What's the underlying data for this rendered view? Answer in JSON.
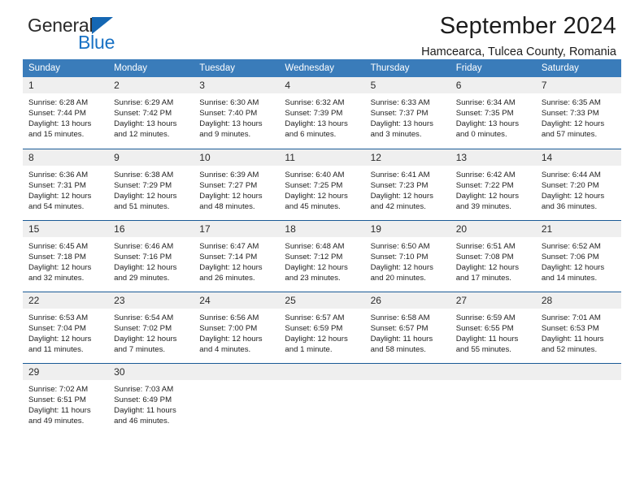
{
  "brand": {
    "name_top": "General",
    "name_bottom": "Blue",
    "triangle_color": "#1567b3",
    "blue_color": "#1871c4"
  },
  "header": {
    "title": "September 2024",
    "subtitle": "Hamcearca, Tulcea County, Romania"
  },
  "theme": {
    "header_bg": "#3a7cba",
    "header_text": "#ffffff",
    "row_divider": "#1a5a96",
    "daynum_bg": "#efefef"
  },
  "weekday_headers": [
    "Sunday",
    "Monday",
    "Tuesday",
    "Wednesday",
    "Thursday",
    "Friday",
    "Saturday"
  ],
  "weeks": [
    [
      {
        "day": "1",
        "sunrise": "Sunrise: 6:28 AM",
        "sunset": "Sunset: 7:44 PM",
        "daylight1": "Daylight: 13 hours",
        "daylight2": "and 15 minutes."
      },
      {
        "day": "2",
        "sunrise": "Sunrise: 6:29 AM",
        "sunset": "Sunset: 7:42 PM",
        "daylight1": "Daylight: 13 hours",
        "daylight2": "and 12 minutes."
      },
      {
        "day": "3",
        "sunrise": "Sunrise: 6:30 AM",
        "sunset": "Sunset: 7:40 PM",
        "daylight1": "Daylight: 13 hours",
        "daylight2": "and 9 minutes."
      },
      {
        "day": "4",
        "sunrise": "Sunrise: 6:32 AM",
        "sunset": "Sunset: 7:39 PM",
        "daylight1": "Daylight: 13 hours",
        "daylight2": "and 6 minutes."
      },
      {
        "day": "5",
        "sunrise": "Sunrise: 6:33 AM",
        "sunset": "Sunset: 7:37 PM",
        "daylight1": "Daylight: 13 hours",
        "daylight2": "and 3 minutes."
      },
      {
        "day": "6",
        "sunrise": "Sunrise: 6:34 AM",
        "sunset": "Sunset: 7:35 PM",
        "daylight1": "Daylight: 13 hours",
        "daylight2": "and 0 minutes."
      },
      {
        "day": "7",
        "sunrise": "Sunrise: 6:35 AM",
        "sunset": "Sunset: 7:33 PM",
        "daylight1": "Daylight: 12 hours",
        "daylight2": "and 57 minutes."
      }
    ],
    [
      {
        "day": "8",
        "sunrise": "Sunrise: 6:36 AM",
        "sunset": "Sunset: 7:31 PM",
        "daylight1": "Daylight: 12 hours",
        "daylight2": "and 54 minutes."
      },
      {
        "day": "9",
        "sunrise": "Sunrise: 6:38 AM",
        "sunset": "Sunset: 7:29 PM",
        "daylight1": "Daylight: 12 hours",
        "daylight2": "and 51 minutes."
      },
      {
        "day": "10",
        "sunrise": "Sunrise: 6:39 AM",
        "sunset": "Sunset: 7:27 PM",
        "daylight1": "Daylight: 12 hours",
        "daylight2": "and 48 minutes."
      },
      {
        "day": "11",
        "sunrise": "Sunrise: 6:40 AM",
        "sunset": "Sunset: 7:25 PM",
        "daylight1": "Daylight: 12 hours",
        "daylight2": "and 45 minutes."
      },
      {
        "day": "12",
        "sunrise": "Sunrise: 6:41 AM",
        "sunset": "Sunset: 7:23 PM",
        "daylight1": "Daylight: 12 hours",
        "daylight2": "and 42 minutes."
      },
      {
        "day": "13",
        "sunrise": "Sunrise: 6:42 AM",
        "sunset": "Sunset: 7:22 PM",
        "daylight1": "Daylight: 12 hours",
        "daylight2": "and 39 minutes."
      },
      {
        "day": "14",
        "sunrise": "Sunrise: 6:44 AM",
        "sunset": "Sunset: 7:20 PM",
        "daylight1": "Daylight: 12 hours",
        "daylight2": "and 36 minutes."
      }
    ],
    [
      {
        "day": "15",
        "sunrise": "Sunrise: 6:45 AM",
        "sunset": "Sunset: 7:18 PM",
        "daylight1": "Daylight: 12 hours",
        "daylight2": "and 32 minutes."
      },
      {
        "day": "16",
        "sunrise": "Sunrise: 6:46 AM",
        "sunset": "Sunset: 7:16 PM",
        "daylight1": "Daylight: 12 hours",
        "daylight2": "and 29 minutes."
      },
      {
        "day": "17",
        "sunrise": "Sunrise: 6:47 AM",
        "sunset": "Sunset: 7:14 PM",
        "daylight1": "Daylight: 12 hours",
        "daylight2": "and 26 minutes."
      },
      {
        "day": "18",
        "sunrise": "Sunrise: 6:48 AM",
        "sunset": "Sunset: 7:12 PM",
        "daylight1": "Daylight: 12 hours",
        "daylight2": "and 23 minutes."
      },
      {
        "day": "19",
        "sunrise": "Sunrise: 6:50 AM",
        "sunset": "Sunset: 7:10 PM",
        "daylight1": "Daylight: 12 hours",
        "daylight2": "and 20 minutes."
      },
      {
        "day": "20",
        "sunrise": "Sunrise: 6:51 AM",
        "sunset": "Sunset: 7:08 PM",
        "daylight1": "Daylight: 12 hours",
        "daylight2": "and 17 minutes."
      },
      {
        "day": "21",
        "sunrise": "Sunrise: 6:52 AM",
        "sunset": "Sunset: 7:06 PM",
        "daylight1": "Daylight: 12 hours",
        "daylight2": "and 14 minutes."
      }
    ],
    [
      {
        "day": "22",
        "sunrise": "Sunrise: 6:53 AM",
        "sunset": "Sunset: 7:04 PM",
        "daylight1": "Daylight: 12 hours",
        "daylight2": "and 11 minutes."
      },
      {
        "day": "23",
        "sunrise": "Sunrise: 6:54 AM",
        "sunset": "Sunset: 7:02 PM",
        "daylight1": "Daylight: 12 hours",
        "daylight2": "and 7 minutes."
      },
      {
        "day": "24",
        "sunrise": "Sunrise: 6:56 AM",
        "sunset": "Sunset: 7:00 PM",
        "daylight1": "Daylight: 12 hours",
        "daylight2": "and 4 minutes."
      },
      {
        "day": "25",
        "sunrise": "Sunrise: 6:57 AM",
        "sunset": "Sunset: 6:59 PM",
        "daylight1": "Daylight: 12 hours",
        "daylight2": "and 1 minute."
      },
      {
        "day": "26",
        "sunrise": "Sunrise: 6:58 AM",
        "sunset": "Sunset: 6:57 PM",
        "daylight1": "Daylight: 11 hours",
        "daylight2": "and 58 minutes."
      },
      {
        "day": "27",
        "sunrise": "Sunrise: 6:59 AM",
        "sunset": "Sunset: 6:55 PM",
        "daylight1": "Daylight: 11 hours",
        "daylight2": "and 55 minutes."
      },
      {
        "day": "28",
        "sunrise": "Sunrise: 7:01 AM",
        "sunset": "Sunset: 6:53 PM",
        "daylight1": "Daylight: 11 hours",
        "daylight2": "and 52 minutes."
      }
    ],
    [
      {
        "day": "29",
        "sunrise": "Sunrise: 7:02 AM",
        "sunset": "Sunset: 6:51 PM",
        "daylight1": "Daylight: 11 hours",
        "daylight2": "and 49 minutes."
      },
      {
        "day": "30",
        "sunrise": "Sunrise: 7:03 AM",
        "sunset": "Sunset: 6:49 PM",
        "daylight1": "Daylight: 11 hours",
        "daylight2": "and 46 minutes."
      },
      {
        "day": "",
        "sunrise": "",
        "sunset": "",
        "daylight1": "",
        "daylight2": ""
      },
      {
        "day": "",
        "sunrise": "",
        "sunset": "",
        "daylight1": "",
        "daylight2": ""
      },
      {
        "day": "",
        "sunrise": "",
        "sunset": "",
        "daylight1": "",
        "daylight2": ""
      },
      {
        "day": "",
        "sunrise": "",
        "sunset": "",
        "daylight1": "",
        "daylight2": ""
      },
      {
        "day": "",
        "sunrise": "",
        "sunset": "",
        "daylight1": "",
        "daylight2": ""
      }
    ]
  ]
}
